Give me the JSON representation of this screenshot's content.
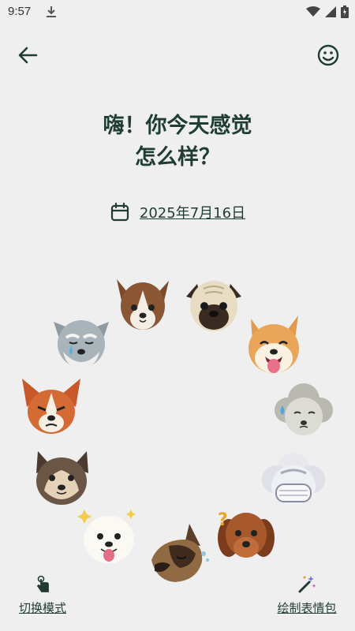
{
  "status_bar": {
    "time": "9:57",
    "icons": [
      "download-icon",
      "wifi-icon",
      "signal-icon",
      "battery-icon"
    ]
  },
  "header": {
    "back_icon": "arrow-left-icon",
    "mood_icon": "smiley-icon"
  },
  "question": {
    "line1": "嗨！你今天感觉",
    "line2": "怎么样？"
  },
  "date": {
    "icon": "calendar-icon",
    "text": "2025年7月16日"
  },
  "moods": [
    "dog-papillon-icon",
    "dog-pug-icon",
    "dog-shiba-laughing-icon",
    "dog-poodle-sweating-icon",
    "dog-sheepdog-masked-icon",
    "dog-retriever-confused-icon",
    "dog-shepherd-sleeping-icon",
    "dog-samoyed-happy-icon",
    "dog-husky-icon",
    "dog-corgi-annoyed-icon",
    "dog-schnauzer-crying-icon"
  ],
  "footer": {
    "switch_mode_label": "切换模式",
    "switch_mode_icon": "tap-hand-icon",
    "draw_emoji_label": "绘制表情包",
    "draw_emoji_icon": "magic-wand-icon"
  },
  "colors": {
    "background": "#efefef",
    "text_dark_green": "#1f3d31"
  }
}
